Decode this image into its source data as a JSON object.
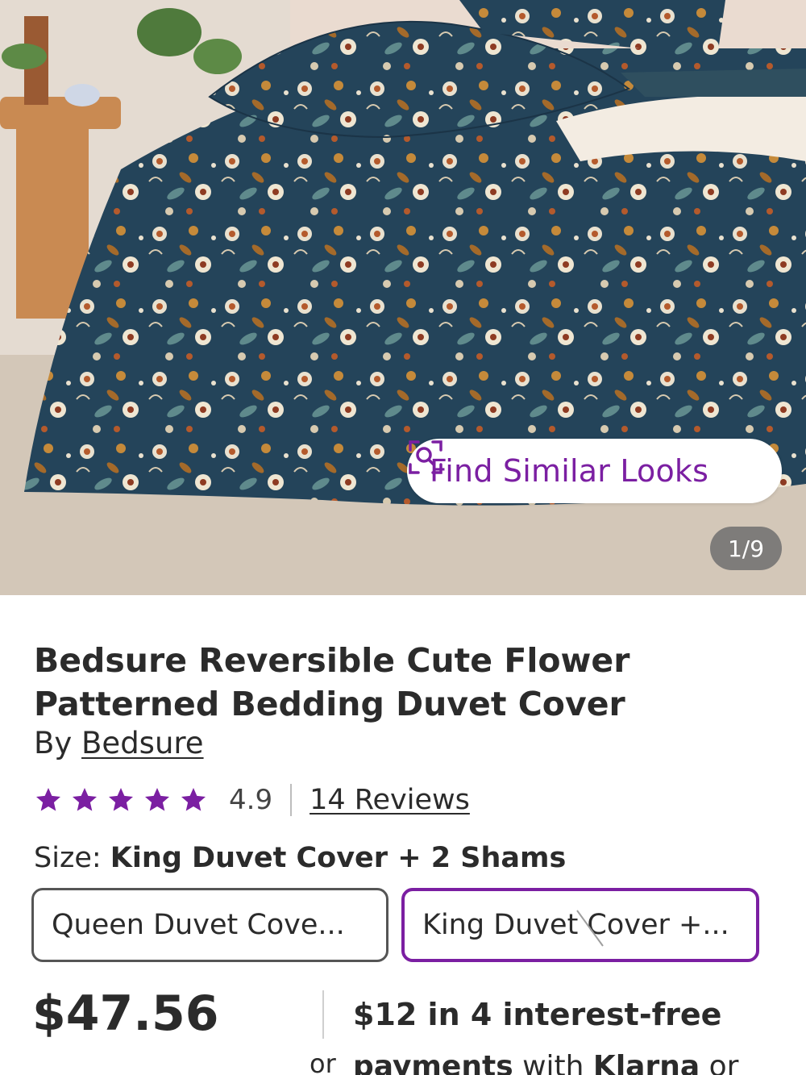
{
  "hero": {
    "find_similar_label": "Find Similar Looks",
    "image_counter": "1/9"
  },
  "product": {
    "title": "Bedsure Reversible Cute Flower Patterned Bedding Duvet Cover",
    "by_prefix": "By",
    "brand": "Bedsure",
    "rating_value": "4.9",
    "star_count": 5,
    "reviews_label": "14 Reviews",
    "size_label": "Size:",
    "size_selected": "King Duvet Cover + 2 Shams",
    "size_options": [
      {
        "label": "Queen Duvet Cove...",
        "selected": false
      },
      {
        "label": "King Duvet Cover +...",
        "selected": true
      }
    ],
    "price": "$47.56",
    "installment_line1": "$12 in 4 interest-free",
    "installment_or": "or",
    "installment_line2_payments": "payments",
    "installment_line2_with": "with",
    "installment_line2_klarna": "Klarna",
    "installment_line2_or": "or"
  },
  "colors": {
    "accent_purple": "#7b1fa2",
    "star_purple": "#7b1fa2",
    "duvet_navy": "#24445a"
  }
}
